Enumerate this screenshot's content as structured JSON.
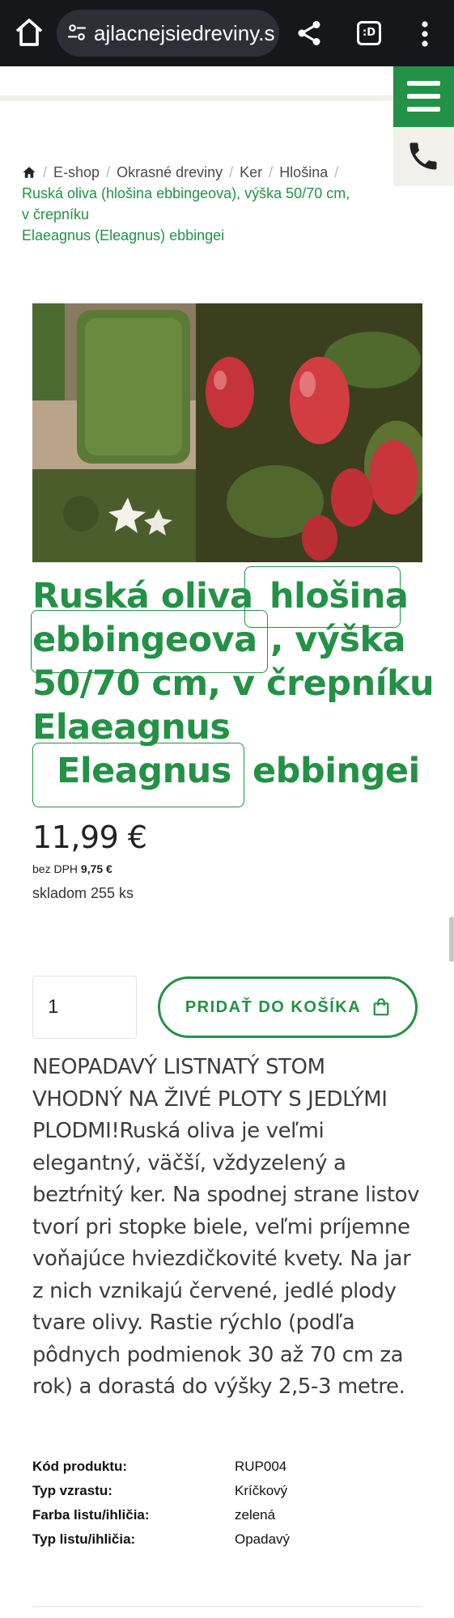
{
  "browser": {
    "url": "ajlacnejsiedreviny.sk",
    "tab_badge": ":D",
    "icons": [
      "home-icon",
      "site-settings-icon",
      "share-icon",
      "tabs-icon",
      "more-vert-icon"
    ]
  },
  "site": {
    "menu_icon": "hamburger-icon",
    "phone_icon": "phone-icon",
    "accent_color": "#239146"
  },
  "breadcrumb": {
    "home_icon": "home-icon",
    "items": [
      "E-shop",
      "Okrasné dreviny",
      "Ker",
      "Hlošina"
    ],
    "current_line1": "Ruská oliva (hlošina ebbingeova), výška 50/70 cm,",
    "current_line2": "v črepníku",
    "current_line3": "Elaeagnus (Eleagnus) ebbingei"
  },
  "product": {
    "image_alt": "product-photo-collage",
    "title_line1_a": "Ruská oliva",
    "title_line1_b": "hlošina",
    "title_line2_a": "ebbingeova",
    "title_line2_b": ", výška",
    "title_line3": "50/70 cm, v črepníku",
    "title_line4": "Elaeagnus",
    "title_line5_a": "Eleagnus",
    "title_line5_b": "ebbingei",
    "price": "11,99 €",
    "vat_label": "bez DPH",
    "vat_price": "9,75 €",
    "stock": "skladom 255 ks",
    "quantity": "1",
    "add_to_cart": "PRIDAŤ DO KOŠÍKA",
    "description": "NEOPADAVÝ LISTNATÝ STOM VHODNÝ NA ŽIVÉ PLOTY S JEDLÝMI PLODMI!Ruská oliva je veľmi elegantný, väčší, vždyzelený a beztŕnitý ker. Na spodnej strane listov tvorí pri stopke biele, veľmi príjemne voňajúce hviezdičkovité kvety. Na jar z nich vznikajú červené, jedlé plody tvare olivy. Rastie rýchlo (podľa pôdnych podmienok 30 až 70 cm za rok) a dorastá do výšky 2,5-3 metre."
  },
  "specs": [
    {
      "label": "Kód produktu:",
      "value": "RUP004"
    },
    {
      "label": "Typ vzrastu:",
      "value": "Kríčkový"
    },
    {
      "label": "Farba listu/ihličia:",
      "value": "zelená"
    },
    {
      "label": "Typ listu/ihličia:",
      "value": "Opadavý"
    }
  ]
}
